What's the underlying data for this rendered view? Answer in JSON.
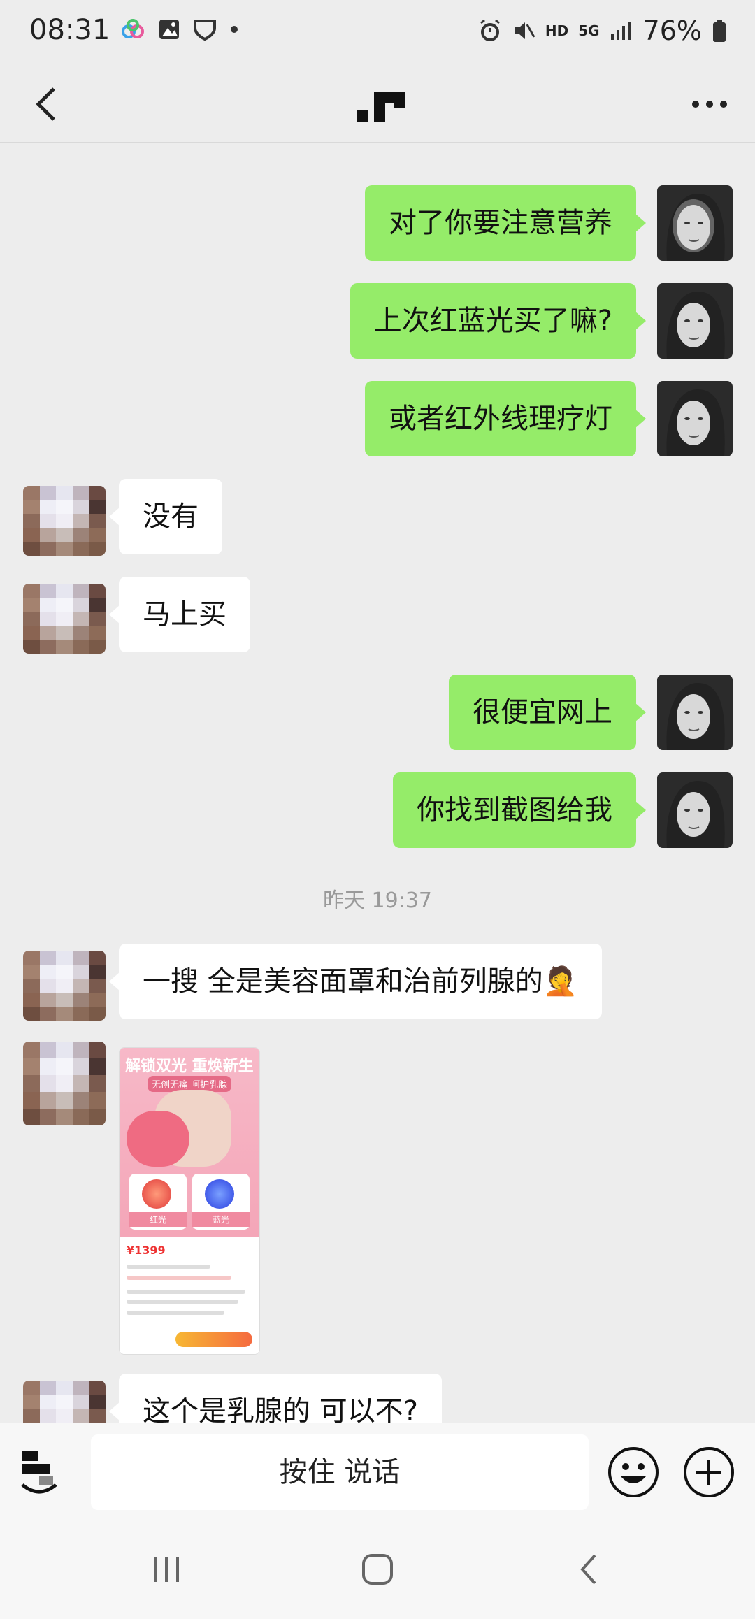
{
  "status_bar": {
    "time": "08:31",
    "battery": "76%",
    "network": "5G",
    "hd": "HD"
  },
  "header": {
    "title_icon": "app-logo-icon"
  },
  "messages": [
    {
      "side": "right",
      "text": "对了你要注意营养"
    },
    {
      "side": "right",
      "text": "上次红蓝光买了嘛?"
    },
    {
      "side": "right",
      "text": "或者红外线理疗灯"
    },
    {
      "side": "left",
      "text": "没有"
    },
    {
      "side": "left",
      "text": "马上买"
    },
    {
      "side": "right",
      "text": "很便宜网上"
    },
    {
      "side": "right",
      "text": "你找到截图给我"
    },
    {
      "side": "left",
      "text": "一搜 全是美容面罩和治前列腺的🤦"
    },
    {
      "side": "left",
      "text": "这个是乳腺的 可以不?"
    }
  ],
  "timestamp": "昨天 19:37",
  "image_message": {
    "title": "解锁双光 重焕新生",
    "tag": "无创无痛 呵护乳腺",
    "card_red": "红光",
    "card_blue": "蓝光",
    "price": "¥1399"
  },
  "input": {
    "talk_label": "按住 说话"
  },
  "colors": {
    "sent_bubble": "#95ec69",
    "received_bubble": "#ffffff",
    "background": "#ededed"
  }
}
